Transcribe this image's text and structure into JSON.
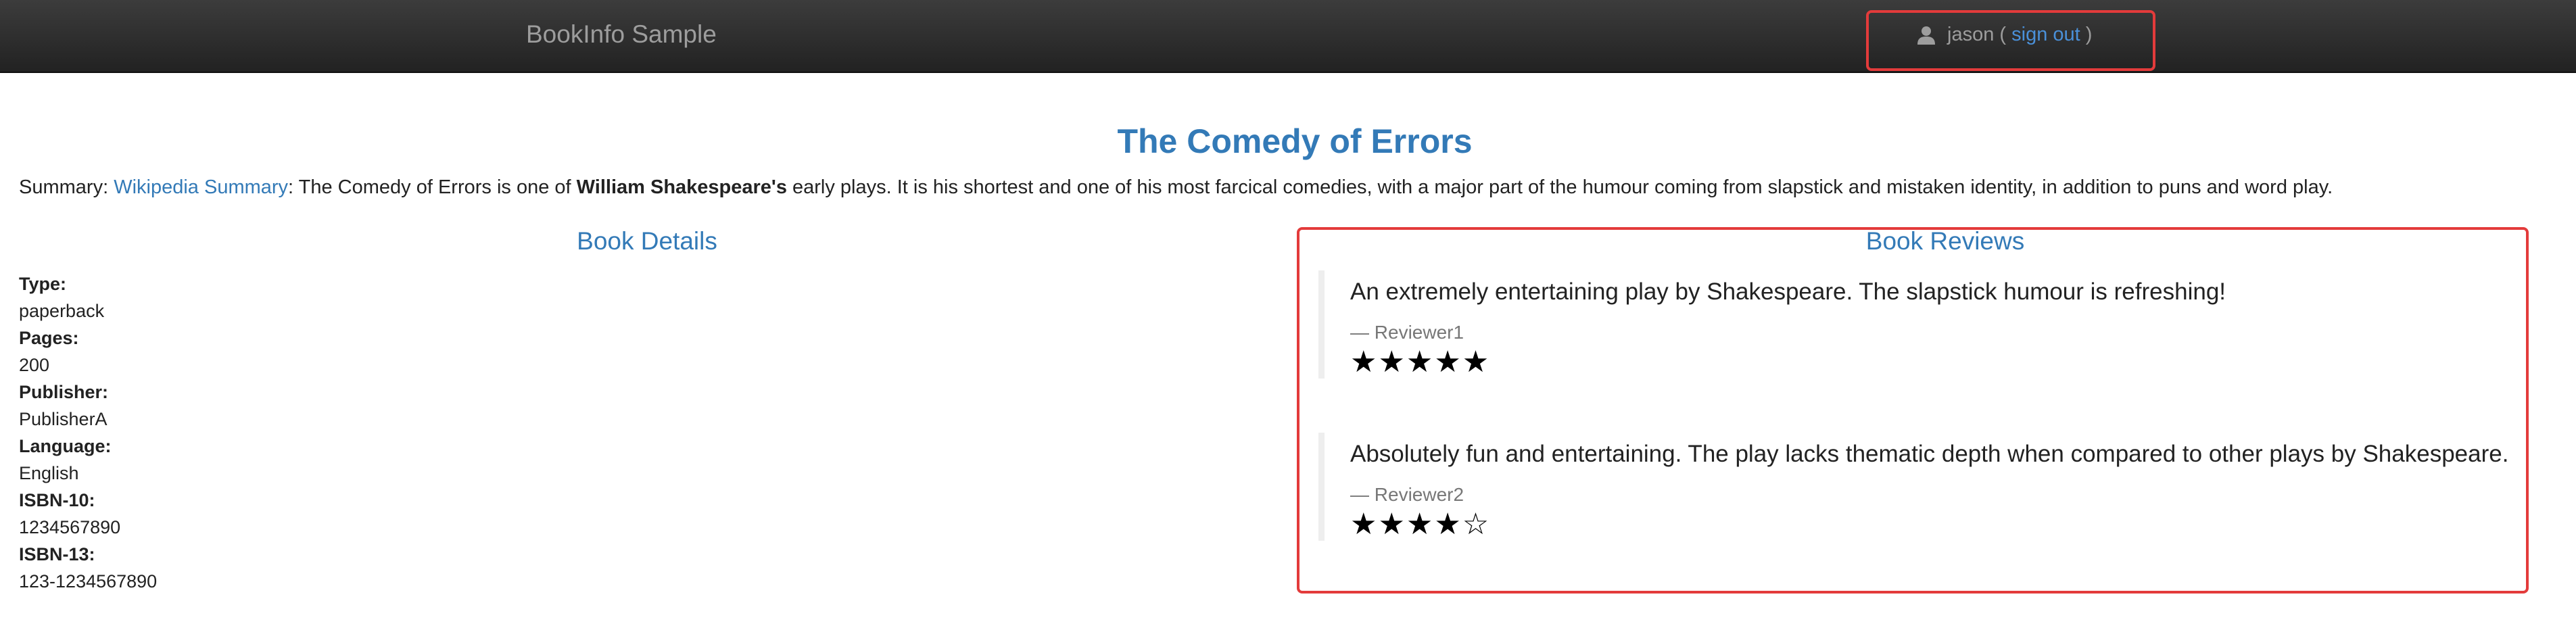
{
  "navbar": {
    "brand": "BookInfo Sample",
    "user": "jason",
    "open_paren": "(",
    "sign_out": "sign out",
    "close_paren": ")"
  },
  "book": {
    "title": "The Comedy of Errors",
    "summary_label": "Summary:",
    "summary_link": "Wikipedia Summary",
    "summary_part1": ": The Comedy of Errors is one of",
    "summary_bold": "William Shakespeare's",
    "summary_part2": "early plays. It is his shortest and one of his most farcical comedies, with a major part of the humour coming from slapstick and mistaken identity, in addition to puns and word play."
  },
  "details": {
    "heading": "Book Details",
    "type_label": "Type:",
    "type": "paperback",
    "pages_label": "Pages:",
    "pages": "200",
    "publisher_label": "Publisher:",
    "publisher": "PublisherA",
    "language_label": "Language:",
    "language": "English",
    "isbn10_label": "ISBN-10:",
    "isbn10": "1234567890",
    "isbn13_label": "ISBN-13:",
    "isbn13": "123-1234567890"
  },
  "reviews": {
    "heading": "Book Reviews",
    "items": [
      {
        "text": "An extremely entertaining play by Shakespeare. The slapstick humour is refreshing!",
        "reviewer": "— Reviewer1",
        "stars_display": "★★★★★",
        "rating": 5
      },
      {
        "text": "Absolutely fun and entertaining. The play lacks thematic depth when compared to other plays by Shakespeare.",
        "reviewer": "— Reviewer2",
        "stars_display": "★★★★☆",
        "rating": 4
      }
    ]
  },
  "colors": {
    "link": "#337ab7",
    "highlight_border": "#e33b3b",
    "navbar": "#2a2a2a"
  }
}
